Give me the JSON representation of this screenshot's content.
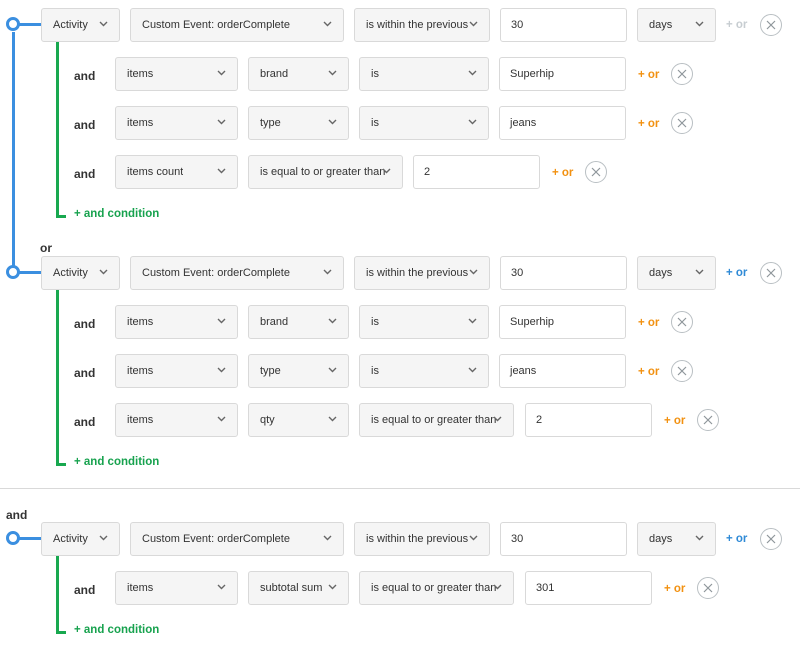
{
  "groups": [
    {
      "conjunction_label": "",
      "main_row": {
        "field1": "Activity",
        "field2": "Custom Event: orderComplete",
        "operator": "is within the previous",
        "value": "30",
        "unit": "days",
        "or_label": "+ or"
      },
      "conditions": [
        {
          "and_label": "and",
          "field": "items",
          "property": "brand",
          "operator": "is",
          "value": "Superhip",
          "or_label": "+ or"
        },
        {
          "and_label": "and",
          "field": "items",
          "property": "type",
          "operator": "is",
          "value": "jeans",
          "or_label": "+ or"
        },
        {
          "and_label": "and",
          "field": "items count",
          "operator": "is equal to or greater than",
          "value": "2",
          "or_label": "+ or"
        }
      ],
      "add_condition_label": "+ and condition"
    },
    {
      "conjunction_label": "or",
      "main_row": {
        "field1": "Activity",
        "field2": "Custom Event: orderComplete",
        "operator": "is within the previous",
        "value": "30",
        "unit": "days",
        "or_label": "+ or"
      },
      "conditions": [
        {
          "and_label": "and",
          "field": "items",
          "property": "brand",
          "operator": "is",
          "value": "Superhip",
          "or_label": "+ or"
        },
        {
          "and_label": "and",
          "field": "items",
          "property": "type",
          "operator": "is",
          "value": "jeans",
          "or_label": "+ or"
        },
        {
          "and_label": "and",
          "field": "items",
          "property": "qty",
          "operator": "is equal to or greater than",
          "value": "2",
          "or_label": "+ or"
        }
      ],
      "add_condition_label": "+ and condition"
    },
    {
      "conjunction_label": "and",
      "main_row": {
        "field1": "Activity",
        "field2": "Custom Event: orderComplete",
        "operator": "is within the previous",
        "value": "30",
        "unit": "days",
        "or_label": "+ or"
      },
      "conditions": [
        {
          "and_label": "and",
          "field": "items",
          "property": "subtotal sum",
          "operator": "is equal to or greater than",
          "value": "301",
          "or_label": "+ or"
        }
      ],
      "add_condition_label": "+ and condition"
    }
  ],
  "colors": {
    "or_link_active": "#2f8ad6",
    "or_link_disabled": "#c7cdd1",
    "condition_or_link": "#f29111",
    "and_condition_link": "#17a24e",
    "group_connector": "#3b8fe0",
    "condition_connector": "#18a84f"
  },
  "icons": {
    "dropdown": "chevron-down-icon",
    "remove": "close-icon",
    "node": "connector-node-icon"
  }
}
